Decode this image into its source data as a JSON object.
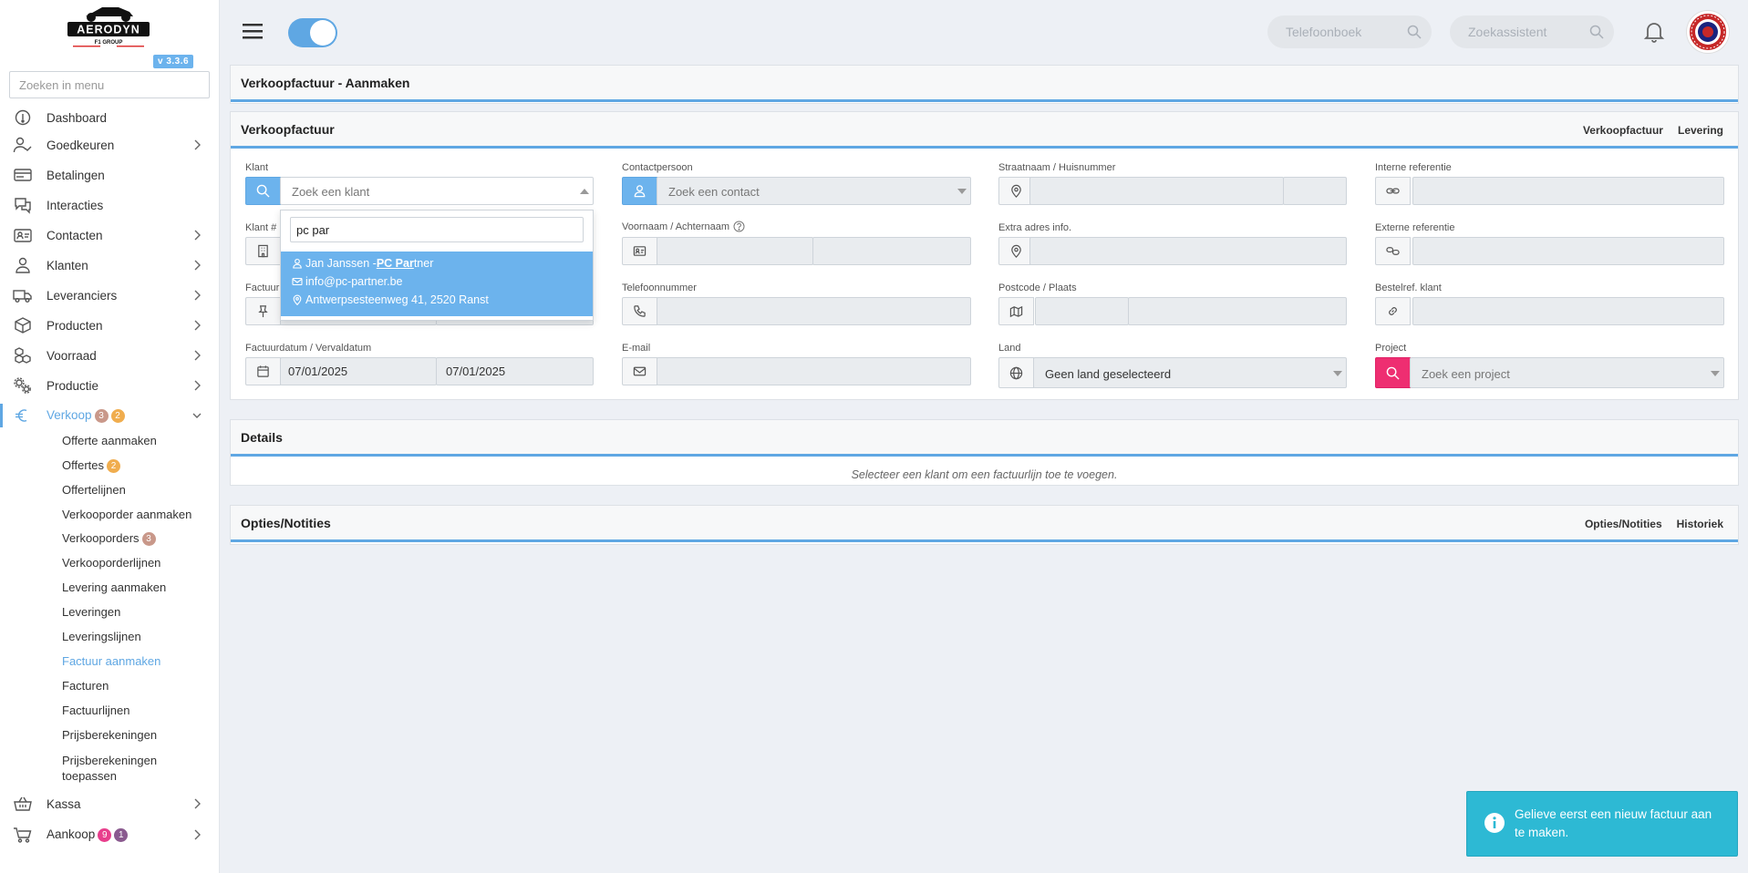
{
  "app": {
    "logo_text": "AERODYN",
    "logo_sub": "F1 GROUP",
    "version": "v 3.3.6",
    "menu_search_placeholder": "Zoeken in menu"
  },
  "sidebar": {
    "items": [
      {
        "label": "Dashboard",
        "icon": "dashboard-icon"
      },
      {
        "label": "Goedkeuren",
        "icon": "user-check-icon"
      },
      {
        "label": "Betalingen",
        "icon": "credit-card-icon"
      },
      {
        "label": "Interacties",
        "icon": "chat-icon"
      },
      {
        "label": "Contacten",
        "icon": "id-card-icon"
      },
      {
        "label": "Klanten",
        "icon": "user-icon"
      },
      {
        "label": "Leveranciers",
        "icon": "truck-icon"
      },
      {
        "label": "Producten",
        "icon": "box-icon"
      },
      {
        "label": "Voorraad",
        "icon": "boxes-icon"
      },
      {
        "label": "Productie",
        "icon": "gears-icon"
      },
      {
        "label": "Verkoop",
        "icon": "euro-icon",
        "badges": [
          "3",
          "2"
        ]
      },
      {
        "label": "Kassa",
        "icon": "basket-icon"
      },
      {
        "label": "Aankoop",
        "icon": "cart-icon",
        "badges": [
          "9",
          "1"
        ]
      }
    ],
    "verkoop_sub": [
      {
        "label": "Offerte aanmaken"
      },
      {
        "label": "Offertes",
        "badge": "2"
      },
      {
        "label": "Offertelijnen"
      },
      {
        "label": "Verkooporder aanmaken"
      },
      {
        "label": "Verkooporders",
        "badge": "3"
      },
      {
        "label": "Verkooporderlijnen"
      },
      {
        "label": "Levering aanmaken"
      },
      {
        "label": "Leveringen"
      },
      {
        "label": "Leveringslijnen"
      },
      {
        "label": "Factuur aanmaken"
      },
      {
        "label": "Facturen"
      },
      {
        "label": "Factuurlijnen"
      },
      {
        "label": "Prijsberekeningen"
      },
      {
        "label": "Prijsberekeningen toepassen"
      }
    ]
  },
  "topbar": {
    "phonebook_placeholder": "Telefoonboek",
    "assistant_placeholder": "Zoekassistent"
  },
  "page": {
    "title": "Verkoopfactuur - Aanmaken"
  },
  "invoice": {
    "header": "Verkoopfactuur",
    "tabs": [
      "Verkoopfactuur",
      "Levering"
    ],
    "labels": {
      "klant": "Klant",
      "klant_nr": "Klant #",
      "factuur": "Factuur",
      "dates": "Factuurdatum / Vervaldatum",
      "contactpersoon": "Contactpersoon",
      "naam": "Voornaam / Achternaam",
      "telefoon": "Telefoonnummer",
      "email": "E-mail",
      "straat": "Straatnaam / Huisnummer",
      "extra": "Extra adres info.",
      "postcode": "Postcode / Plaats",
      "land": "Land",
      "interne_ref": "Interne referentie",
      "externe_ref": "Externe referentie",
      "bestelref": "Bestelref. klant",
      "project": "Project"
    },
    "klant_placeholder": "Zoek een klant",
    "contact_placeholder": "Zoek een contact",
    "project_placeholder": "Zoek een project",
    "land_value": "Geen land geselecteerd",
    "factuurdatum": "07/01/2025",
    "vervaldatum": "07/01/2025"
  },
  "klant_dropdown": {
    "search_value": "pc par",
    "result": {
      "name_prefix": "Jan Janssen - ",
      "name_match1": "PC Par",
      "name_rest": "tner",
      "email": "info@pc-partner.be",
      "address": "Antwerpsesteenweg 41, 2520 Ranst"
    }
  },
  "details": {
    "header": "Details",
    "empty_message": "Selecteer een klant om een factuurlijn toe te voegen."
  },
  "options": {
    "header": "Opties/Notities",
    "tabs": [
      "Opties/Notities",
      "Historiek"
    ]
  },
  "toast": {
    "message": "Gelieve eerst een nieuw factuur aan te maken."
  },
  "colors": {
    "accent": "#5fa7e3",
    "project_addon": "#ee2e71",
    "toast": "#2db9d4"
  }
}
